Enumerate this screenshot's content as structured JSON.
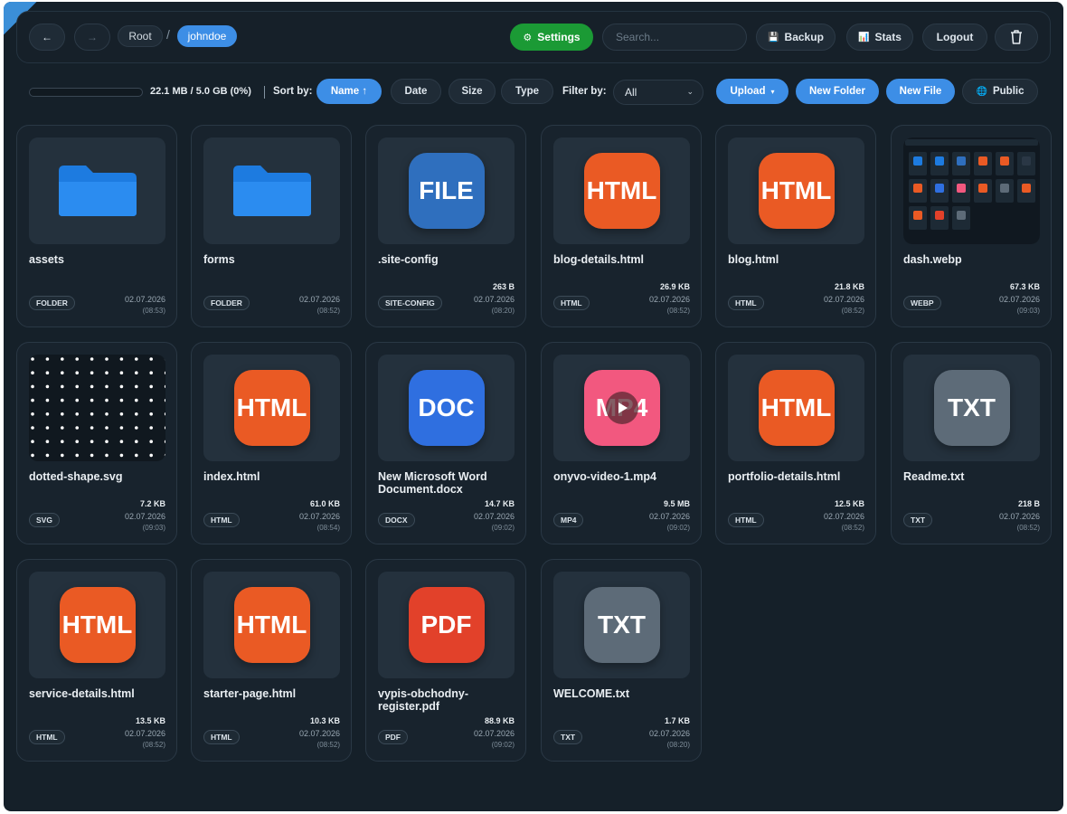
{
  "nav": {
    "back_icon": "←",
    "forward_icon": "→",
    "breadcrumbs": [
      "Root",
      "johndoe"
    ],
    "breadcrumb_separator": "/"
  },
  "header": {
    "settings_label": "Settings",
    "settings_icon": "⚙",
    "search_placeholder": "Search...",
    "backup_label": "Backup",
    "backup_icon": "💾",
    "stats_label": "Stats",
    "stats_icon": "📊",
    "logout_label": "Logout",
    "trash_icon": "trash-icon"
  },
  "toolbar": {
    "storage_text": "22.1 MB / 5.0 GB (0%)",
    "storage_fraction": 0.0,
    "sort_label": "Sort by:",
    "sort_name": "Name ↑",
    "sort_date": "Date",
    "sort_size": "Size",
    "sort_type": "Type",
    "filter_label": "Filter by:",
    "filter_value": "All",
    "filter_caret": "⌄",
    "upload_label": "Upload",
    "upload_caret": "▾",
    "new_folder_label": "New Folder",
    "new_file_label": "New File",
    "public_label": "Public",
    "public_icon": "🌐"
  },
  "files": [
    {
      "name": "assets",
      "kind": "folder",
      "badge": "FOLDER",
      "size": "",
      "date": "02.07.2026",
      "time": "(08:53)"
    },
    {
      "name": "forms",
      "kind": "folder",
      "badge": "FOLDER",
      "size": "",
      "date": "02.07.2026",
      "time": "(08:52)"
    },
    {
      "name": ".site-config",
      "kind": "icon",
      "icon_text": "FILE",
      "color": "#2f6fbe",
      "badge": "SITE-CONFIG",
      "size": "263 B",
      "date": "02.07.2026",
      "time": "(08:20)"
    },
    {
      "name": "blog-details.html",
      "kind": "icon",
      "icon_text": "HTML",
      "color": "#ea5a24",
      "badge": "HTML",
      "size": "26.9 KB",
      "date": "02.07.2026",
      "time": "(08:52)"
    },
    {
      "name": "blog.html",
      "kind": "icon",
      "icon_text": "HTML",
      "color": "#ea5a24",
      "badge": "HTML",
      "size": "21.8 KB",
      "date": "02.07.2026",
      "time": "(08:52)"
    },
    {
      "name": "dash.webp",
      "kind": "screenshot",
      "badge": "WEBP",
      "size": "67.3 KB",
      "date": "02.07.2026",
      "time": "(09:03)"
    },
    {
      "name": "dotted-shape.svg",
      "kind": "dots",
      "badge": "SVG",
      "size": "7.2 KB",
      "date": "02.07.2026",
      "time": "(09:03)"
    },
    {
      "name": "index.html",
      "kind": "icon",
      "icon_text": "HTML",
      "color": "#ea5a24",
      "badge": "HTML",
      "size": "61.0 KB",
      "date": "02.07.2026",
      "time": "(08:54)"
    },
    {
      "name": "New Microsoft Word Document.docx",
      "kind": "icon",
      "icon_text": "DOC",
      "color": "#2f6fe0",
      "badge": "DOCX",
      "size": "14.7 KB",
      "date": "02.07.2026",
      "time": "(09:02)"
    },
    {
      "name": "onyvo-video-1.mp4",
      "kind": "video",
      "icon_text": "MP4",
      "color": "#f2587f",
      "badge": "MP4",
      "size": "9.5 MB",
      "date": "02.07.2026",
      "time": "(09:02)"
    },
    {
      "name": "portfolio-details.html",
      "kind": "icon",
      "icon_text": "HTML",
      "color": "#ea5a24",
      "badge": "HTML",
      "size": "12.5 KB",
      "date": "02.07.2026",
      "time": "(08:52)"
    },
    {
      "name": "Readme.txt",
      "kind": "icon",
      "icon_text": "TXT",
      "color": "#5d6b78",
      "badge": "TXT",
      "size": "218 B",
      "date": "02.07.2026",
      "time": "(08:52)"
    },
    {
      "name": "service-details.html",
      "kind": "icon",
      "icon_text": "HTML",
      "color": "#ea5a24",
      "badge": "HTML",
      "size": "13.5 KB",
      "date": "02.07.2026",
      "time": "(08:52)"
    },
    {
      "name": "starter-page.html",
      "kind": "icon",
      "icon_text": "HTML",
      "color": "#ea5a24",
      "badge": "HTML",
      "size": "10.3 KB",
      "date": "02.07.2026",
      "time": "(08:52)"
    },
    {
      "name": "vypis-obchodny-register.pdf",
      "kind": "icon",
      "icon_text": "PDF",
      "color": "#e2412a",
      "badge": "PDF",
      "size": "88.9 KB",
      "date": "02.07.2026",
      "time": "(09:02)"
    },
    {
      "name": "WELCOME.txt",
      "kind": "icon",
      "icon_text": "TXT",
      "color": "#5d6b78",
      "badge": "TXT",
      "size": "1.7 KB",
      "date": "02.07.2026",
      "time": "(08:20)"
    }
  ]
}
